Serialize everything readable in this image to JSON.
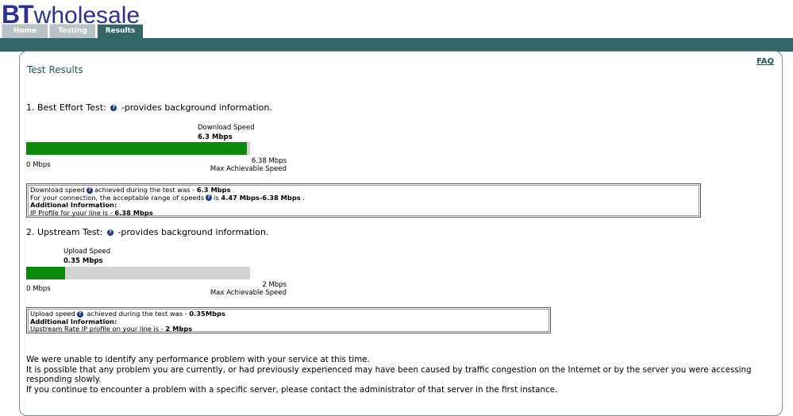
{
  "logo": {
    "bt": "BT",
    "wholesale": "wholesale"
  },
  "tabs": [
    {
      "label": "Home"
    },
    {
      "label": "Testing"
    },
    {
      "label": "Results"
    }
  ],
  "faq": "FAQ",
  "page_title": "Test Results",
  "best_effort": {
    "heading_prefix": "1. Best Effort Test:",
    "heading_suffix": "-provides background information.",
    "speed_label": "Download Speed",
    "speed_value": "6.3 Mbps",
    "fill_fraction": 0.9875,
    "scale_min": "0 Mbps",
    "scale_max": "6.38 Mbps",
    "scale_max_label": "Max Achievable Speed",
    "info": {
      "line1_pre": "Download speed",
      "line1_mid": "achieved during the test was - ",
      "line1_val": "6.3 Mbps",
      "line2_pre": "For your connection, the acceptable range of speeds",
      "line2_mid": "is ",
      "line2_val": "4.47 Mbps-6.38 Mbps",
      "line2_end": " .",
      "additional": "Additional Information:",
      "line4_pre": "IP Profile for your line is - ",
      "line4_val": "6.38 Mbps"
    }
  },
  "upstream": {
    "heading_prefix": "2. Upstream Test:",
    "heading_suffix": "-provides background information.",
    "speed_label": "Upload Speed",
    "speed_value": "0.35 Mbps",
    "fill_fraction": 0.175,
    "scale_min": "0 Mbps",
    "scale_max": "2 Mbps",
    "scale_max_label": "Max Achievable Speed",
    "info": {
      "line1_pre": "Upload speed",
      "line1_mid": " achieved during the test was - ",
      "line1_val": "0.35Mbps",
      "additional": "Additional Information:",
      "line3_pre": "Upstream Rate IP profile on your line is - ",
      "line3_val": "2 Mbps"
    }
  },
  "summary": {
    "p1": "We were unable to identify any performance problem with your service at this time.",
    "p2": "It is possible that any problem you are currently, or had previously experienced may have been caused by traffic congestion on the Internet or by the server you were accessing responding slowly.",
    "p3": "If you continue to encounter a problem with a specific server, please contact the administrator of that server in the first instance."
  },
  "colors": {
    "brand": "#2a2f9c",
    "band": "#336666",
    "bar": "#0a8a0a"
  }
}
